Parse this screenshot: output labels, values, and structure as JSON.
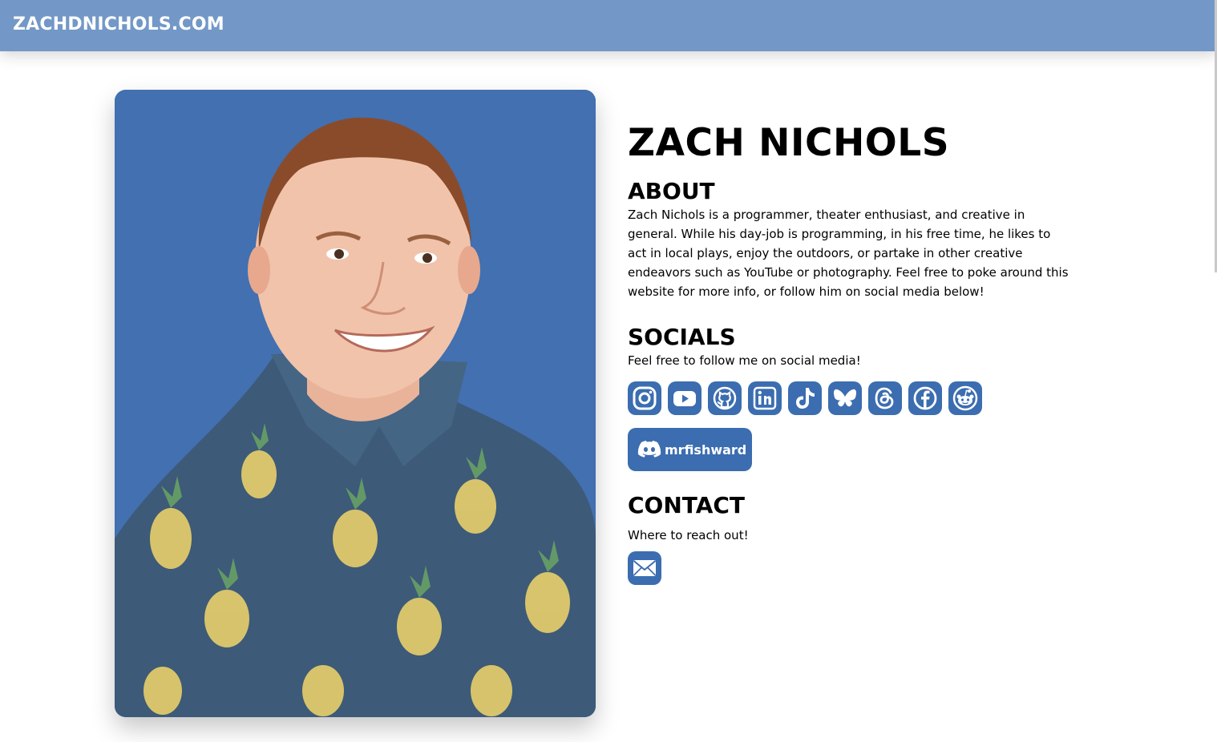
{
  "header": {
    "site_title": "ZACHDNICHOLS.COM",
    "background_color": "#7398c7"
  },
  "portrait": {
    "background_color": "#4270b0"
  },
  "profile": {
    "name": "ZACH NICHOLS"
  },
  "about": {
    "heading": "ABOUT",
    "text": "Zach Nichols is a programmer, theater enthusiast, and creative in general. While his day-job is programming, in his free time, he likes to act in local plays, enjoy the outdoors, or partake in other creative endeavors such as YouTube or photography. Feel free to poke around this website for more info, or follow him on social media below!"
  },
  "socials": {
    "heading": "SOCIALS",
    "text": "Feel free to follow me on social media!",
    "accent_color": "#3b6db0",
    "links": [
      {
        "icon": "instagram-icon"
      },
      {
        "icon": "youtube-icon"
      },
      {
        "icon": "github-icon"
      },
      {
        "icon": "linkedin-icon"
      },
      {
        "icon": "tiktok-icon"
      },
      {
        "icon": "bluesky-icon"
      },
      {
        "icon": "threads-icon"
      },
      {
        "icon": "facebook-icon"
      },
      {
        "icon": "reddit-icon"
      }
    ],
    "discord": {
      "icon": "discord-icon",
      "username": "mrfishward"
    }
  },
  "contact": {
    "heading": "CONTACT",
    "text": "Where to reach out!",
    "email_icon": "mail-icon"
  }
}
